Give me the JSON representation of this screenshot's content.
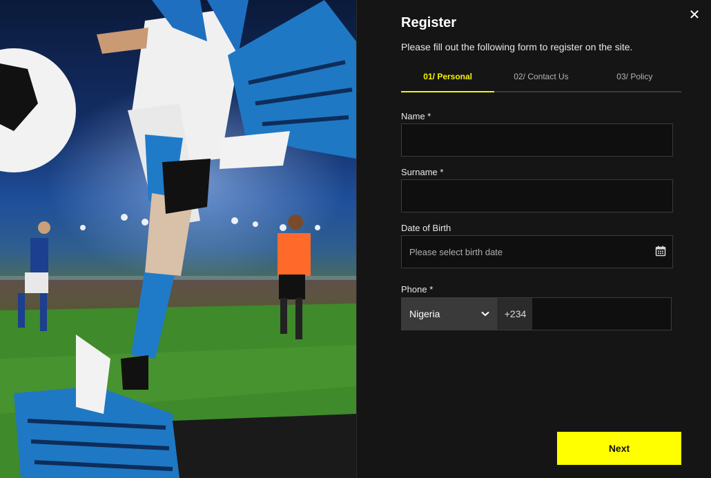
{
  "colors": {
    "accent": "#ffff00",
    "panel_bg": "#151515",
    "field_bg": "#0f0f0f"
  },
  "dialog": {
    "title": "Register",
    "subtitle": "Please fill out the following form to register on the site.",
    "close_icon": "close-icon"
  },
  "tabs": [
    {
      "label": "01/ Personal",
      "active": true
    },
    {
      "label": "02/ Contact Us",
      "active": false
    },
    {
      "label": "03/ Policy",
      "active": false
    }
  ],
  "form": {
    "name_label": "Name *",
    "name_value": "",
    "surname_label": "Surname *",
    "surname_value": "",
    "dob_label": "Date of Birth",
    "dob_placeholder": "Please select birth date",
    "dob_icon": "calendar-icon",
    "phone_label": "Phone *",
    "phone_country": "Nigeria",
    "phone_dial_code": "+234",
    "phone_value": ""
  },
  "actions": {
    "next_label": "Next"
  },
  "hero": {
    "image_icon": "football-stadium-image"
  }
}
